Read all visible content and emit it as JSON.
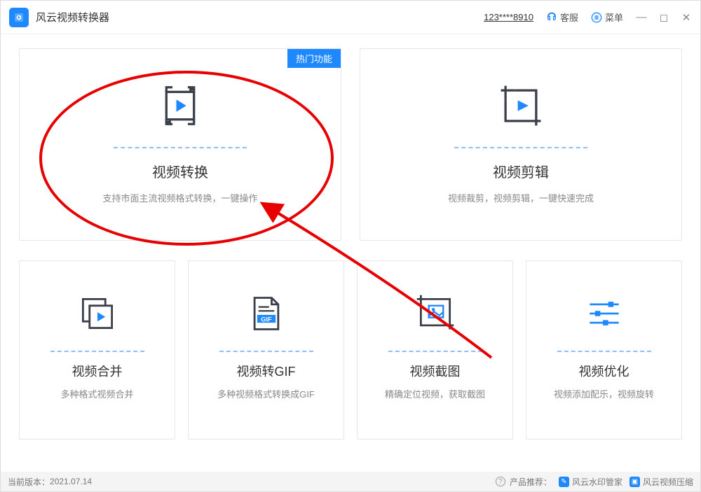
{
  "app": {
    "title": "风云视频转换器"
  },
  "header": {
    "account": "123****8910",
    "service": "客服",
    "menu": "菜单"
  },
  "cards": {
    "convert": {
      "badge": "热门功能",
      "title": "视频转换",
      "desc": "支持市面主流视频格式转换，一键操作"
    },
    "edit": {
      "title": "视频剪辑",
      "desc": "视频裁剪，视频剪辑，一键快速完成"
    },
    "merge": {
      "title": "视频合并",
      "desc": "多种格式视频合并"
    },
    "gif": {
      "title": "视频转GIF",
      "desc": "多种视频格式转换成GIF",
      "chip": "GIF"
    },
    "screenshot": {
      "title": "视频截图",
      "desc": "精确定位视频，获取截图"
    },
    "optimize": {
      "title": "视频优化",
      "desc": "视频添加配乐，视频旋转"
    }
  },
  "footer": {
    "version_label": "当前版本：",
    "version": "2021.07.14",
    "recommend": "产品推荐：",
    "rec1": "风云水印管家",
    "rec2": "风云视频压缩"
  }
}
